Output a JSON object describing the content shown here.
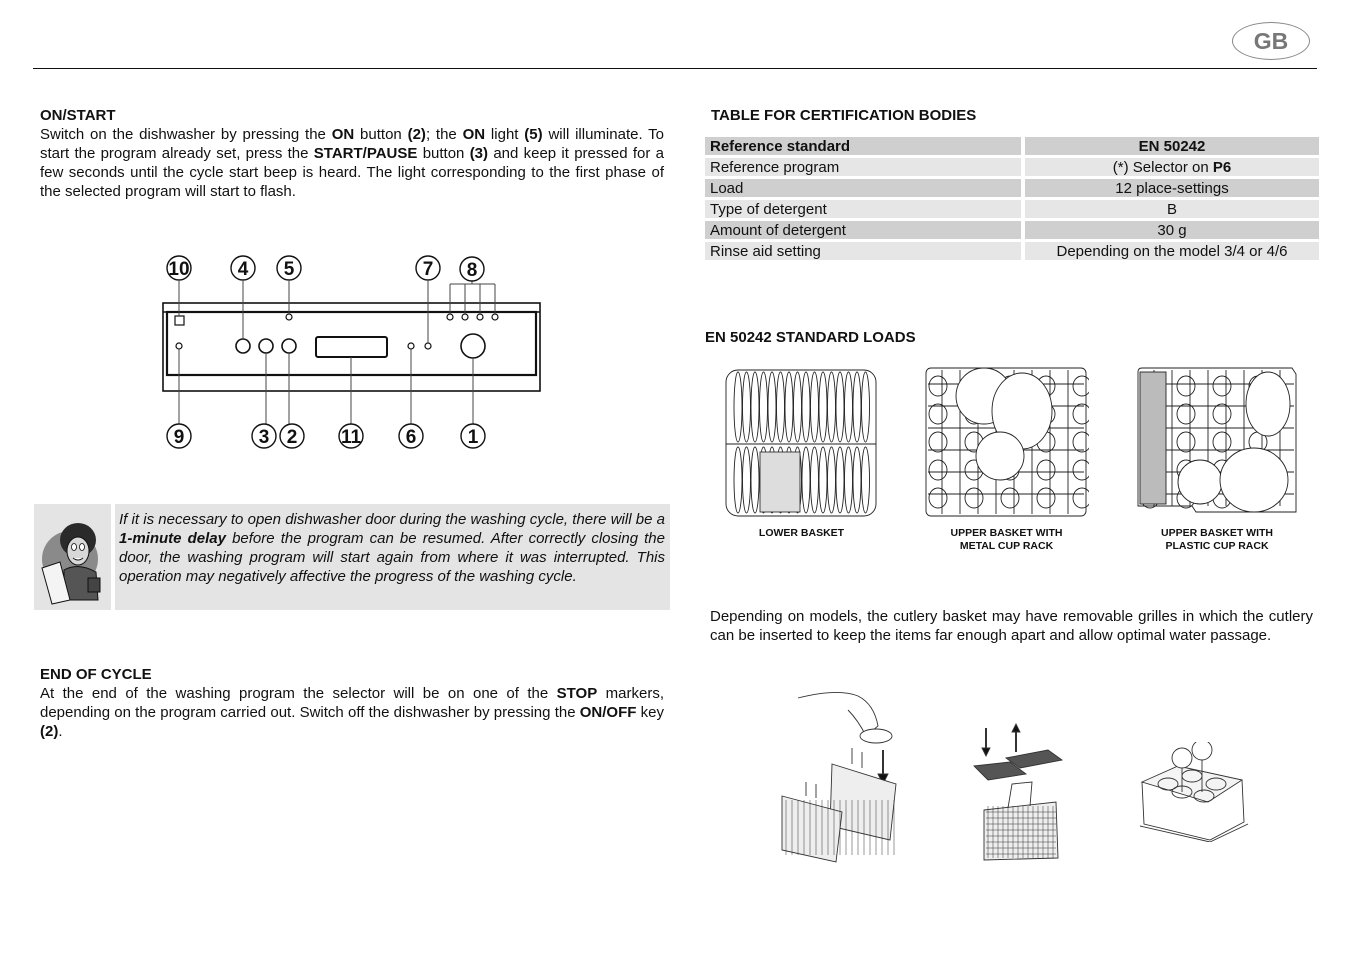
{
  "header": {
    "language_badge": "GB"
  },
  "left": {
    "on_start": {
      "title": "ON/START",
      "paragraph": [
        {
          "t": "Switch on the dishwasher by pressing the "
        },
        {
          "t": "ON",
          "b": true
        },
        {
          "t": " button "
        },
        {
          "t": "(2)",
          "b": true
        },
        {
          "t": "; the "
        },
        {
          "t": "ON",
          "b": true
        },
        {
          "t": " light "
        },
        {
          "t": "(5)",
          "b": true
        },
        {
          "t": " will illuminate. To start the program already set, press the "
        },
        {
          "t": "START/PAUSE",
          "b": true
        },
        {
          "t": " button "
        },
        {
          "t": "(3)",
          "b": true
        },
        {
          "t": " and keep it pressed for a few seconds until the cycle start beep is heard. The light corresponding to the first phase of the selected program will start to flash."
        }
      ]
    },
    "control_panel": {
      "top_labels": [
        "10",
        "4",
        "5",
        "7",
        "8"
      ],
      "bottom_labels": [
        "9",
        "3",
        "2",
        "11",
        "6",
        "1"
      ]
    },
    "note": {
      "icon": "warning-person-icon",
      "paragraph": [
        {
          "t": "If it is necessary to open dishwasher door during the washing cycle, there will be a "
        },
        {
          "t": "1-minute delay",
          "b": true
        },
        {
          "t": " before the program can be resumed. After correctly closing the door, the washing program will start again from where it was interrupted. This operation may negatively affective the progress of the washing cycle."
        }
      ]
    },
    "end_of_cycle": {
      "title": "END OF CYCLE",
      "paragraph": [
        {
          "t": "At the end of the washing program the selector will be on one of the "
        },
        {
          "t": "STOP",
          "b": true
        },
        {
          "t": " markers, depending on the program carried out. Switch off the dishwasher by pressing the "
        },
        {
          "t": "ON/OFF",
          "b": true
        },
        {
          "t": " key "
        },
        {
          "t": "(2)",
          "b": true
        },
        {
          "t": "."
        }
      ]
    }
  },
  "right": {
    "cert_table": {
      "title": "TABLE FOR CERTIFICATION BODIES",
      "header": {
        "label": "Reference standard",
        "value": "EN 50242"
      },
      "rows": [
        {
          "label": "Reference program",
          "value_prefix": "(*) Selector on ",
          "value_bold": "P6"
        },
        {
          "label": "Load",
          "value_prefix": "12 place-settings",
          "value_bold": ""
        },
        {
          "label": "Type of detergent",
          "value_prefix": "B",
          "value_bold": ""
        },
        {
          "label": "Amount of detergent",
          "value_prefix": "30 g",
          "value_bold": ""
        },
        {
          "label": "Rinse aid setting",
          "value_prefix": "Depending on the model 3/4 or 4/6",
          "value_bold": ""
        }
      ]
    },
    "standard_loads": {
      "title": "EN 50242 STANDARD LOADS",
      "baskets": [
        {
          "caption_line1": "LOWER BASKET",
          "caption_line2": ""
        },
        {
          "caption_line1": "UPPER BASKET WITH",
          "caption_line2": "METAL CUP RACK"
        },
        {
          "caption_line1": "UPPER BASKET WITH",
          "caption_line2": "PLASTIC CUP RACK"
        }
      ]
    },
    "cutlery": {
      "paragraph": "Depending on models, the cutlery basket may have removable grilles in which the cutlery can be inserted to keep the items far enough apart and allow optimal water passage."
    }
  }
}
